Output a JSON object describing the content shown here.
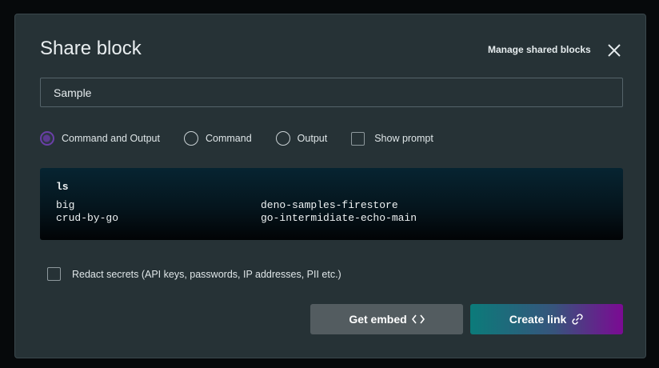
{
  "dialog": {
    "title": "Share block",
    "manage_link": "Manage shared blocks"
  },
  "name_input": {
    "value": "Sample"
  },
  "options": {
    "command_and_output": "Command and Output",
    "command": "Command",
    "output": "Output",
    "show_prompt": "Show prompt",
    "selected": "command_and_output"
  },
  "terminal": {
    "command": "ls",
    "rows": [
      [
        "big",
        "deno-samples-firestore"
      ],
      [
        "crud-by-go",
        "go-intermidiate-echo-main"
      ]
    ]
  },
  "redact": {
    "label": "Redact secrets (API keys, passwords, IP addresses, PII etc.)"
  },
  "buttons": {
    "get_embed": "Get embed",
    "create_link": "Create link"
  },
  "colors": {
    "dialog_bg": "#263236",
    "accent_purple": "#6a3fa8",
    "link_gradient_start": "#0b7b7a",
    "link_gradient_end": "#7b0a93"
  },
  "icons": {
    "close": "close-icon",
    "embed": "code-brackets-icon",
    "link": "link-icon"
  }
}
